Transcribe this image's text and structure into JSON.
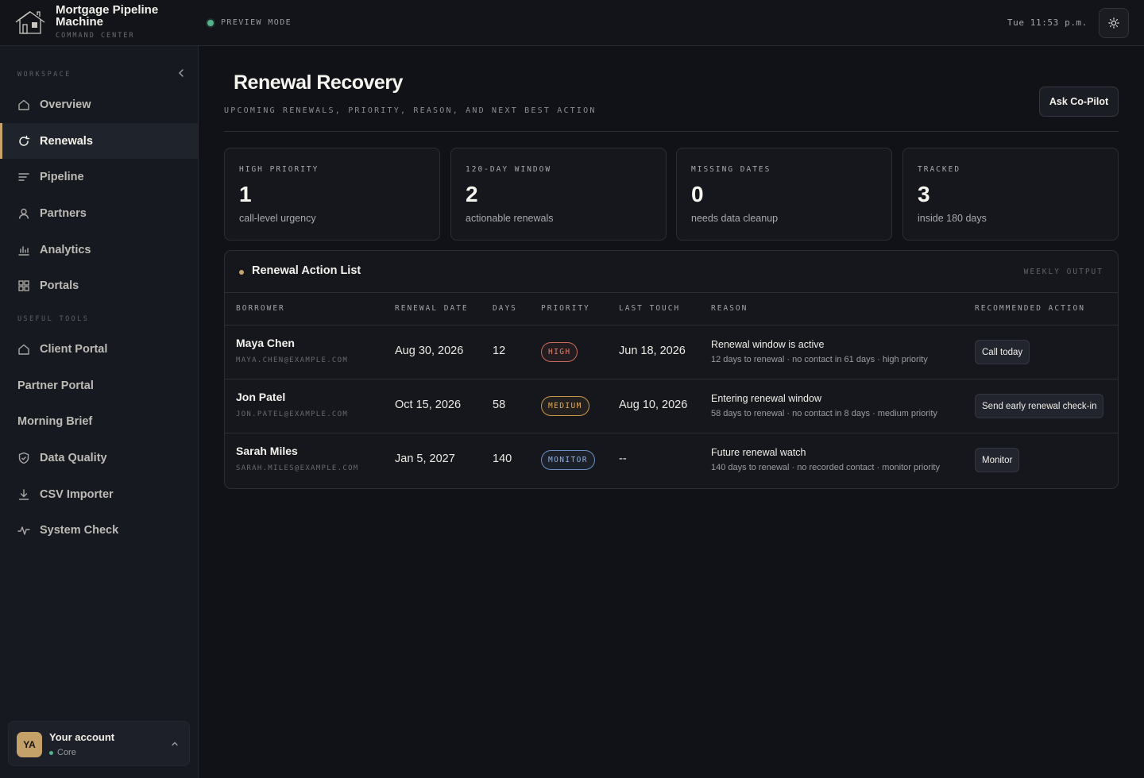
{
  "app": {
    "title": "Mortgage Pipeline Machine",
    "subtitle": "COMMAND CENTER",
    "preview": "PREVIEW MODE",
    "clock": "Tue 11:53 p.m."
  },
  "sidebar": {
    "workspace_label": "WORKSPACE",
    "tools_label": "USEFUL TOOLS",
    "workspace_items": [
      {
        "label": "Overview",
        "icon": "home-icon"
      },
      {
        "label": "Renewals",
        "icon": "refresh-icon",
        "active": true
      },
      {
        "label": "Pipeline",
        "icon": "list-icon"
      },
      {
        "label": "Partners",
        "icon": "user-icon"
      },
      {
        "label": "Analytics",
        "icon": "bar-chart-icon"
      },
      {
        "label": "Portals",
        "icon": "grid-icon"
      }
    ],
    "tool_items": [
      {
        "label": "Client Portal",
        "icon": "home-icon"
      },
      {
        "label": "Partner Portal",
        "icon": ""
      },
      {
        "label": "Morning Brief",
        "icon": ""
      },
      {
        "label": "Data Quality",
        "icon": "shield-check-icon"
      },
      {
        "label": "CSV Importer",
        "icon": "download-icon"
      },
      {
        "label": "System Check",
        "icon": "activity-icon"
      }
    ],
    "account": {
      "initials": "YA",
      "name": "Your account",
      "plan": "Core"
    }
  },
  "main": {
    "title": "Renewal Recovery",
    "subtitle": "UPCOMING RENEWALS, PRIORITY, REASON, AND NEXT BEST ACTION",
    "copilot_label": "Ask Co-Pilot",
    "stats": [
      {
        "label": "HIGH PRIORITY",
        "value": "1",
        "desc": "call-level urgency"
      },
      {
        "label": "120-DAY WINDOW",
        "value": "2",
        "desc": "actionable renewals"
      },
      {
        "label": "MISSING DATES",
        "value": "0",
        "desc": "needs data cleanup"
      },
      {
        "label": "TRACKED",
        "value": "3",
        "desc": "inside 180 days"
      }
    ],
    "panel": {
      "title": "Renewal Action List",
      "tag": "WEEKLY OUTPUT",
      "columns": [
        "BORROWER",
        "RENEWAL DATE",
        "DAYS",
        "PRIORITY",
        "LAST TOUCH",
        "REASON",
        "RECOMMENDED ACTION"
      ],
      "rows": [
        {
          "name": "Maya Chen",
          "email": "MAYA.CHEN@EXAMPLE.COM",
          "date": "Aug 30, 2026",
          "days": "12",
          "priority": "HIGH",
          "priority_class": "high",
          "last_touch": "Jun 18, 2026",
          "reason": "Renewal window is active",
          "reason_detail": "12 days to renewal · no contact in 61 days · high priority",
          "action": "Call today"
        },
        {
          "name": "Jon Patel",
          "email": "JON.PATEL@EXAMPLE.COM",
          "date": "Oct 15, 2026",
          "days": "58",
          "priority": "MEDIUM",
          "priority_class": "medium",
          "last_touch": "Aug 10, 2026",
          "reason": "Entering renewal window",
          "reason_detail": "58 days to renewal · no contact in 8 days · medium priority",
          "action": "Send early renewal check-in"
        },
        {
          "name": "Sarah Miles",
          "email": "SARAH.MILES@EXAMPLE.COM",
          "date": "Jan 5, 2027",
          "days": "140",
          "priority": "MONITOR",
          "priority_class": "monitor",
          "last_touch": "--",
          "reason": "Future renewal watch",
          "reason_detail": "140 days to renewal · no recorded contact · monitor priority",
          "action": "Monitor"
        }
      ]
    }
  },
  "colors": {
    "accent": "#c6a46c",
    "background": "#101217",
    "status_ok": "#56b28a",
    "high": "#e2816d",
    "medium": "#e0ac5c",
    "monitor": "#8fb1e2"
  }
}
